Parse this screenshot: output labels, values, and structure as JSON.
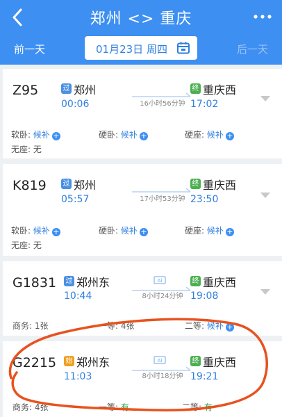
{
  "header": {
    "title": "郑州 <> 重庆",
    "prev_day": "前一天",
    "next_day": "后一天",
    "date": "01月23日 周四"
  },
  "trains": [
    {
      "no": "Z95",
      "from_badge": "过",
      "from": "郑州",
      "depart": "00:06",
      "duration": "16小时56分钟",
      "to_badge": "终",
      "to": "重庆西",
      "arrive": "17:02",
      "seats": [
        {
          "label": "软卧: ",
          "value": "候补"
        },
        {
          "label": "硬卧: ",
          "value": "候补"
        },
        {
          "label": "硬座: ",
          "value": "候补"
        },
        {
          "label": "无座: ",
          "value": "无"
        }
      ]
    },
    {
      "no": "K819",
      "from_badge": "过",
      "from": "郑州",
      "depart": "05:57",
      "duration": "17小时53分钟",
      "to_badge": "终",
      "to": "重庆西",
      "arrive": "23:50",
      "seats": [
        {
          "label": "软卧: ",
          "value": "候补"
        },
        {
          "label": "硬卧: ",
          "value": "候补"
        },
        {
          "label": "硬座: ",
          "value": "候补"
        },
        {
          "label": "无座: ",
          "value": "无"
        }
      ]
    },
    {
      "no": "G1831",
      "from_badge": "过",
      "from": "郑州东",
      "depart": "10:44",
      "duration": "8小时24分钟",
      "to_badge": "终",
      "to": "重庆西",
      "arrive": "19:08",
      "seats": [
        {
          "label": "商务: ",
          "value": "1张"
        },
        {
          "label": "一等: ",
          "value": "4张"
        },
        {
          "label": "二等: ",
          "value": "候补"
        }
      ]
    },
    {
      "no": "G2215",
      "from_badge": "始",
      "from": "郑州东",
      "depart": "11:03",
      "duration": "8小时18分钟",
      "to_badge": "终",
      "to": "重庆西",
      "arrive": "19:21",
      "seats": [
        {
          "label": "商务: ",
          "value": "4张"
        },
        {
          "label": "一等: ",
          "value": "有"
        },
        {
          "label": "二等: ",
          "value": "有"
        }
      ]
    }
  ],
  "colors": {
    "header": "#3d8ff2",
    "accent": "#2f7fe0",
    "badge_pass": "#4a90e2",
    "badge_terminal": "#4caf50",
    "badge_start": "#f0a020",
    "available_green": "#37a046",
    "annotation_circle": "#e8521e"
  }
}
